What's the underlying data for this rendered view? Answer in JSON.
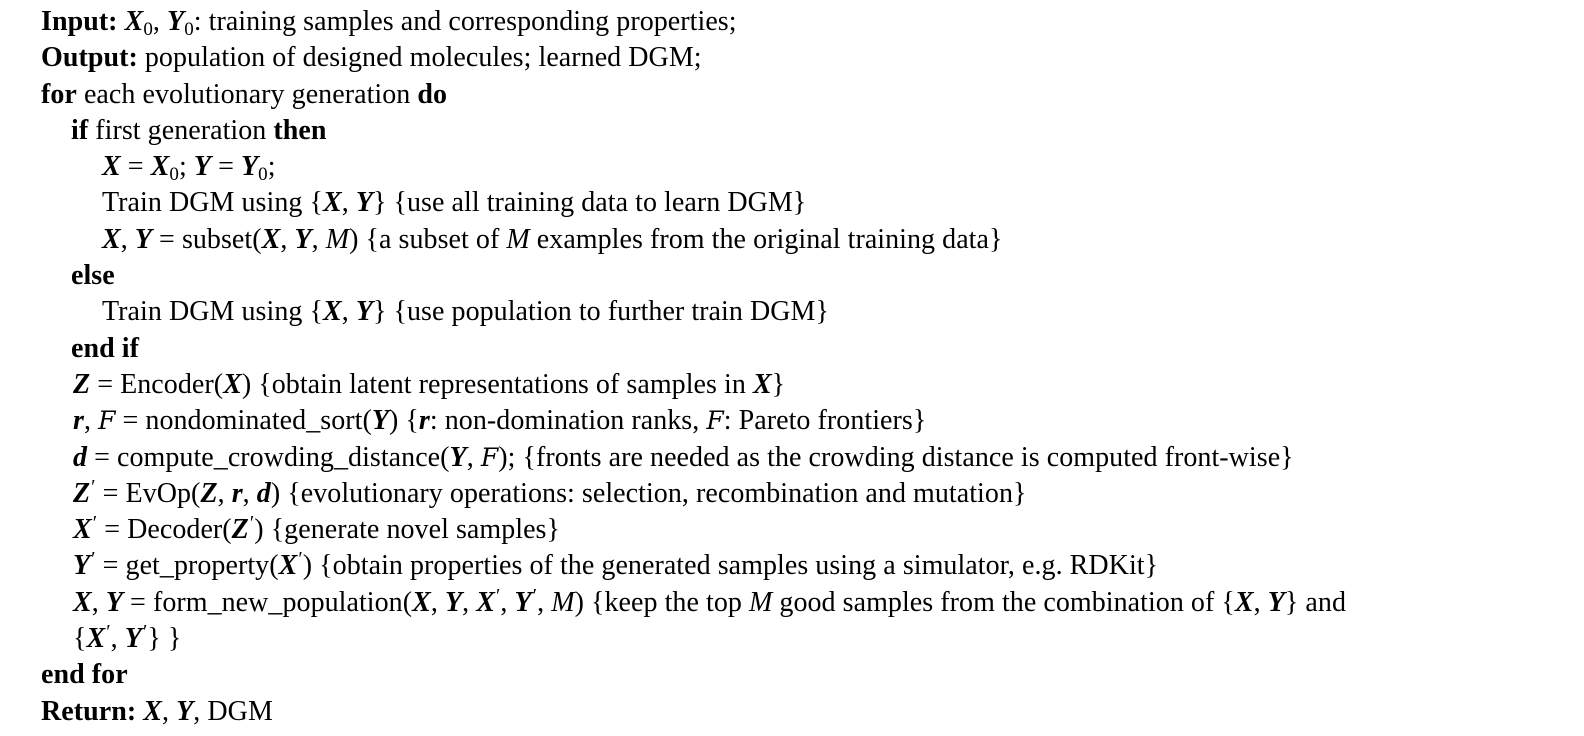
{
  "algorithm": {
    "lines": [
      {
        "indent": 0,
        "parts": [
          {
            "s": "kw",
            "t": "Input:"
          },
          {
            "t": " "
          },
          {
            "s": "bv",
            "t": "X"
          },
          {
            "s": "sub",
            "t": "0"
          },
          {
            "t": ", "
          },
          {
            "s": "bv",
            "t": "Y"
          },
          {
            "s": "sub",
            "t": "0"
          },
          {
            "t": ": training samples and corresponding properties;"
          }
        ]
      },
      {
        "indent": 0,
        "parts": [
          {
            "s": "kw",
            "t": "Output:"
          },
          {
            "t": " population of designed molecules; learned DGM;"
          }
        ]
      },
      {
        "indent": 0,
        "parts": [
          {
            "s": "kw",
            "t": "for"
          },
          {
            "t": " each evolutionary generation "
          },
          {
            "s": "kw",
            "t": "do"
          }
        ]
      },
      {
        "indent": 1,
        "parts": [
          {
            "s": "kw",
            "t": "if"
          },
          {
            "t": " first generation "
          },
          {
            "s": "kw",
            "t": "then"
          }
        ]
      },
      {
        "indent": 2,
        "parts": [
          {
            "s": "bv",
            "t": "X"
          },
          {
            "t": " = "
          },
          {
            "s": "bv",
            "t": "X"
          },
          {
            "s": "sub",
            "t": "0"
          },
          {
            "t": "; "
          },
          {
            "s": "bv",
            "t": "Y"
          },
          {
            "t": " = "
          },
          {
            "s": "bv",
            "t": "Y"
          },
          {
            "s": "sub",
            "t": "0"
          },
          {
            "t": ";"
          }
        ]
      },
      {
        "indent": 2,
        "parts": [
          {
            "t": "Train DGM using {"
          },
          {
            "s": "bv",
            "t": "X"
          },
          {
            "t": ", "
          },
          {
            "s": "bv",
            "t": "Y"
          },
          {
            "t": "} {use all training data to learn DGM}"
          }
        ]
      },
      {
        "indent": 2,
        "parts": [
          {
            "s": "bv",
            "t": "X"
          },
          {
            "t": ", "
          },
          {
            "s": "bv",
            "t": "Y"
          },
          {
            "t": " = subset("
          },
          {
            "s": "bv",
            "t": "X"
          },
          {
            "t": ", "
          },
          {
            "s": "bv",
            "t": "Y"
          },
          {
            "t": ", "
          },
          {
            "s": "it",
            "t": "M"
          },
          {
            "t": ") {a subset of "
          },
          {
            "s": "it",
            "t": "M"
          },
          {
            "t": " examples from the original training data}"
          }
        ]
      },
      {
        "indent": 1,
        "parts": [
          {
            "s": "kw",
            "t": "else"
          }
        ]
      },
      {
        "indent": 2,
        "parts": [
          {
            "t": "Train DGM using {"
          },
          {
            "s": "bv",
            "t": "X"
          },
          {
            "t": ", "
          },
          {
            "s": "bv",
            "t": "Y"
          },
          {
            "t": "} {use population to further train DGM}"
          }
        ]
      },
      {
        "indent": 1,
        "parts": [
          {
            "s": "kw",
            "t": "end if"
          }
        ]
      },
      {
        "indent": 3,
        "parts": [
          {
            "s": "bv",
            "t": "Z"
          },
          {
            "t": " = Encoder("
          },
          {
            "s": "bv",
            "t": "X"
          },
          {
            "t": ") {obtain latent representations of samples in "
          },
          {
            "s": "bv",
            "t": "X"
          },
          {
            "t": "}"
          }
        ]
      },
      {
        "indent": 3,
        "parts": [
          {
            "s": "bv",
            "t": "r"
          },
          {
            "t": ", "
          },
          {
            "s": "cal",
            "t": "F"
          },
          {
            "t": " = nondominated_sort("
          },
          {
            "s": "bv",
            "t": "Y"
          },
          {
            "t": ") {"
          },
          {
            "s": "bv",
            "t": "r"
          },
          {
            "t": ": non-domination ranks, "
          },
          {
            "s": "cal",
            "t": "F"
          },
          {
            "t": ": Pareto frontiers}"
          }
        ]
      },
      {
        "indent": 3,
        "parts": [
          {
            "s": "bv",
            "t": "d"
          },
          {
            "t": " = compute_crowding_distance("
          },
          {
            "s": "bv",
            "t": "Y"
          },
          {
            "t": ", "
          },
          {
            "s": "cal",
            "t": "F"
          },
          {
            "t": "); {fronts are needed as the crowding distance is computed front-wise}"
          }
        ]
      },
      {
        "indent": 3,
        "parts": [
          {
            "s": "bv",
            "t": "Z"
          },
          {
            "s": "pr",
            "t": "′"
          },
          {
            "t": " = EvOp("
          },
          {
            "s": "bv",
            "t": "Z"
          },
          {
            "t": ", "
          },
          {
            "s": "bv",
            "t": "r"
          },
          {
            "t": ", "
          },
          {
            "s": "bv",
            "t": "d"
          },
          {
            "t": ") {evolutionary operations: selection, recombination and mutation}"
          }
        ]
      },
      {
        "indent": 3,
        "parts": [
          {
            "s": "bv",
            "t": "X"
          },
          {
            "s": "pr",
            "t": "′"
          },
          {
            "t": " = Decoder("
          },
          {
            "s": "bv",
            "t": "Z"
          },
          {
            "s": "pr",
            "t": "′"
          },
          {
            "t": ") {generate novel samples}"
          }
        ]
      },
      {
        "indent": 3,
        "parts": [
          {
            "s": "bv",
            "t": "Y"
          },
          {
            "s": "pr",
            "t": "′"
          },
          {
            "t": " = get_property("
          },
          {
            "s": "bv",
            "t": "X"
          },
          {
            "s": "pr",
            "t": "′"
          },
          {
            "t": ") {obtain properties of the generated samples using a simulator, e.g. RDKit}"
          }
        ]
      },
      {
        "indent": 3,
        "parts": [
          {
            "s": "bv",
            "t": "X"
          },
          {
            "t": ", "
          },
          {
            "s": "bv",
            "t": "Y"
          },
          {
            "t": " = form_new_population("
          },
          {
            "s": "bv",
            "t": "X"
          },
          {
            "t": ", "
          },
          {
            "s": "bv",
            "t": "Y"
          },
          {
            "t": ", "
          },
          {
            "s": "bv",
            "t": "X"
          },
          {
            "s": "pr",
            "t": "′"
          },
          {
            "t": ", "
          },
          {
            "s": "bv",
            "t": "Y"
          },
          {
            "s": "pr",
            "t": "′"
          },
          {
            "t": ", "
          },
          {
            "s": "it",
            "t": "M"
          },
          {
            "t": ") {keep the top "
          },
          {
            "s": "it",
            "t": "M"
          },
          {
            "t": " good samples from the combination of {"
          },
          {
            "s": "bv",
            "t": "X"
          },
          {
            "t": ", "
          },
          {
            "s": "bv",
            "t": "Y"
          },
          {
            "t": "} and"
          }
        ]
      },
      {
        "indent": 3,
        "parts": [
          {
            "t": "{"
          },
          {
            "s": "bv",
            "t": "X"
          },
          {
            "s": "pr",
            "t": "′"
          },
          {
            "t": ", "
          },
          {
            "s": "bv",
            "t": "Y"
          },
          {
            "s": "pr",
            "t": "′"
          },
          {
            "t": "} }"
          }
        ]
      },
      {
        "indent": 0,
        "parts": [
          {
            "s": "kw",
            "t": "end for"
          }
        ]
      },
      {
        "indent": 0,
        "parts": [
          {
            "s": "kw",
            "t": "Return:"
          },
          {
            "t": " "
          },
          {
            "s": "bv",
            "t": "X"
          },
          {
            "t": ", "
          },
          {
            "s": "bv",
            "t": "Y"
          },
          {
            "t": ", DGM"
          }
        ]
      }
    ]
  }
}
